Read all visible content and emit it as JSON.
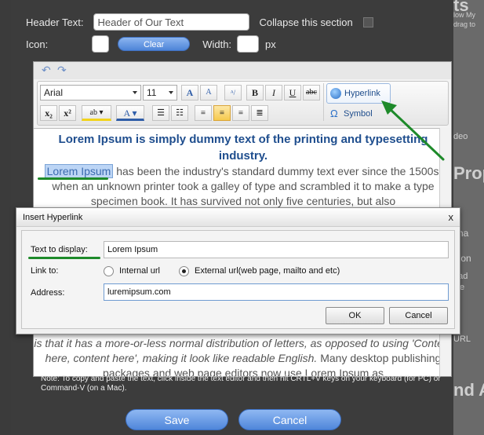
{
  "panel": {
    "header_text_label": "Header Text:",
    "header_text_value": "Header of Our Text",
    "collapse_label": "Collapse this section",
    "icon_label": "Icon:",
    "clear_label": "Clear",
    "width_label": "Width:",
    "px_label": "px"
  },
  "toolbar": {
    "font": "Arial",
    "size": "11",
    "hyperlink_label": "Hyperlink",
    "symbol_label": "Symbol"
  },
  "document": {
    "heading": "Lorem Ipsum is simply dummy text of the printing and typesetting industry.",
    "selected": "Lorem Ipsum",
    "p1_rest": " has been the industry's standard dummy text ever since the 1500s, when an unknown printer took a galley of type and scrambled it to make a type specimen book. It has survived not only five centuries, but also",
    "p2_italic": "is that it has a more-or-less normal distribution of letters, as opposed to using 'Content here, content here', making it look like readable English.",
    "p2_rest": " Many desktop publishing packages and web page editors now use Lorem Ipsum as"
  },
  "note": "Note: To copy and paste the text, click inside the text editor and then hit CRTL+V keys on your keyboard (for PC) or Command-V (on a Mac).",
  "actions": {
    "save": "Save",
    "cancel": "Cancel"
  },
  "dialog": {
    "title": "Insert Hyperlink",
    "close": "x",
    "text_label": "Text to display:",
    "text_value": "Lorem Ipsum",
    "link_label": "Link to:",
    "internal_label": "Internal url",
    "external_label": "External url(web page, mailto and etc)",
    "selected_link_type": "External url(web page, mailto and etc)",
    "address_label": "Address:",
    "address_value": "luremipsum.com",
    "ok": "OK",
    "cancel": "Cancel"
  },
  "background": {
    "t1": "ts",
    "t2": "low My",
    "t3": "drag to",
    "t4": "deo",
    "t5": "Prop",
    "t6": "ima",
    "t7": ".con",
    "t8": "oad",
    "t9": "file",
    "t10": "URL",
    "t11": "nd A"
  },
  "accent_colors": {
    "annotation_green": "#1e8a2a",
    "heading_blue": "#1f4e8e",
    "button_blue": "#4f86da"
  }
}
